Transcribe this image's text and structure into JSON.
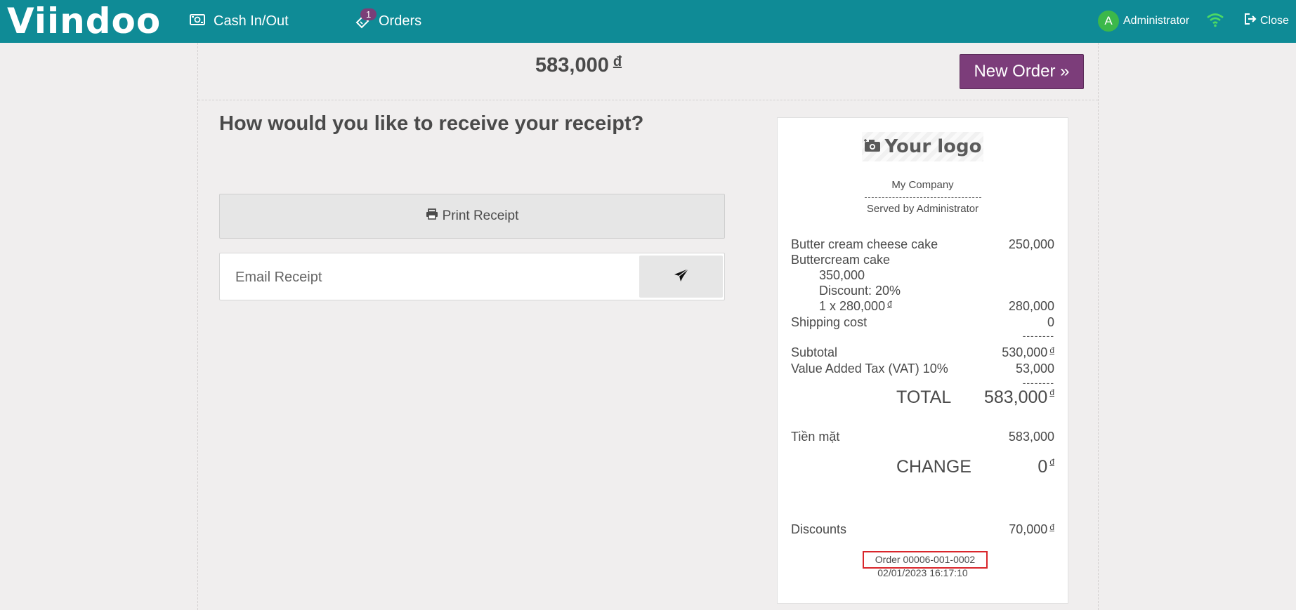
{
  "header": {
    "logo_text": "Viindoo",
    "cash_label": "Cash In/Out",
    "orders_label": "Orders",
    "orders_badge": "1",
    "user_initial": "A",
    "user_name": "Administrator",
    "close_label": "Close"
  },
  "payment": {
    "amount": "583,000",
    "currency": "đ",
    "new_order_label": "New Order »"
  },
  "receipt_options": {
    "question": "How would you like to receive your receipt?",
    "print_label": "Print Receipt",
    "email_placeholder": "Email Receipt"
  },
  "receipt": {
    "logo_text": "Your logo",
    "company": "My Company",
    "served_by": "Served by Administrator",
    "lines": [
      {
        "name": "Butter cream cheese cake",
        "amount": "250,000"
      },
      {
        "name": "Buttercream cake",
        "amount": ""
      },
      {
        "name": "350,000",
        "amount": ""
      },
      {
        "name": "Discount: 20%",
        "amount": ""
      },
      {
        "name": "1 x 280,000",
        "amount": "280,000"
      },
      {
        "name": "Shipping cost",
        "amount": "0"
      }
    ],
    "dashes": "--------",
    "subtotal_label": "Subtotal",
    "subtotal_value": "530,000",
    "tax_label": "Value Added Tax (VAT) 10%",
    "tax_value": "53,000",
    "total_label": "TOTAL",
    "total_value": "583,000",
    "payment_method": "Tiền mặt",
    "payment_value": "583,000",
    "change_label": "CHANGE",
    "change_value": "0",
    "discounts_label": "Discounts",
    "discounts_value": "70,000",
    "currency": "đ",
    "order_ref": "Order 00006-001-0002",
    "datetime": "02/01/2023 16:17:10"
  },
  "colors": {
    "topbar": "#0f8b96",
    "new_order": "#7c3d7a",
    "highlight": "#d9262b"
  }
}
